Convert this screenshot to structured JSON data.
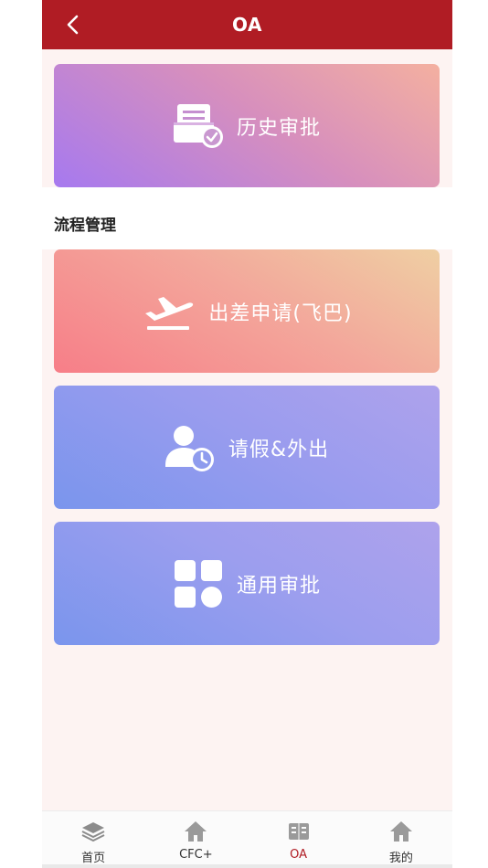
{
  "header": {
    "title": "OA"
  },
  "cards": {
    "history": {
      "label": "历史审批",
      "icon": "document-check-icon"
    },
    "business_trip": {
      "label": "出差申请(飞巴)",
      "icon": "airplane-takeoff-icon"
    },
    "leave": {
      "label": "请假&外出",
      "icon": "person-clock-icon"
    },
    "general": {
      "label": "通用审批",
      "icon": "grid-apps-icon"
    }
  },
  "section": {
    "title": "流程管理"
  },
  "tabbar": {
    "items": [
      {
        "label": "首页",
        "icon": "layers-icon",
        "active": false
      },
      {
        "label": "CFC+",
        "icon": "house-icon",
        "active": false
      },
      {
        "label": "OA",
        "icon": "oa-book-icon",
        "active": true
      },
      {
        "label": "我的",
        "icon": "house-icon",
        "active": false
      }
    ]
  },
  "colors": {
    "header": "#b01c24",
    "active_tab": "#b01c24",
    "background": "#fdf3f2"
  }
}
